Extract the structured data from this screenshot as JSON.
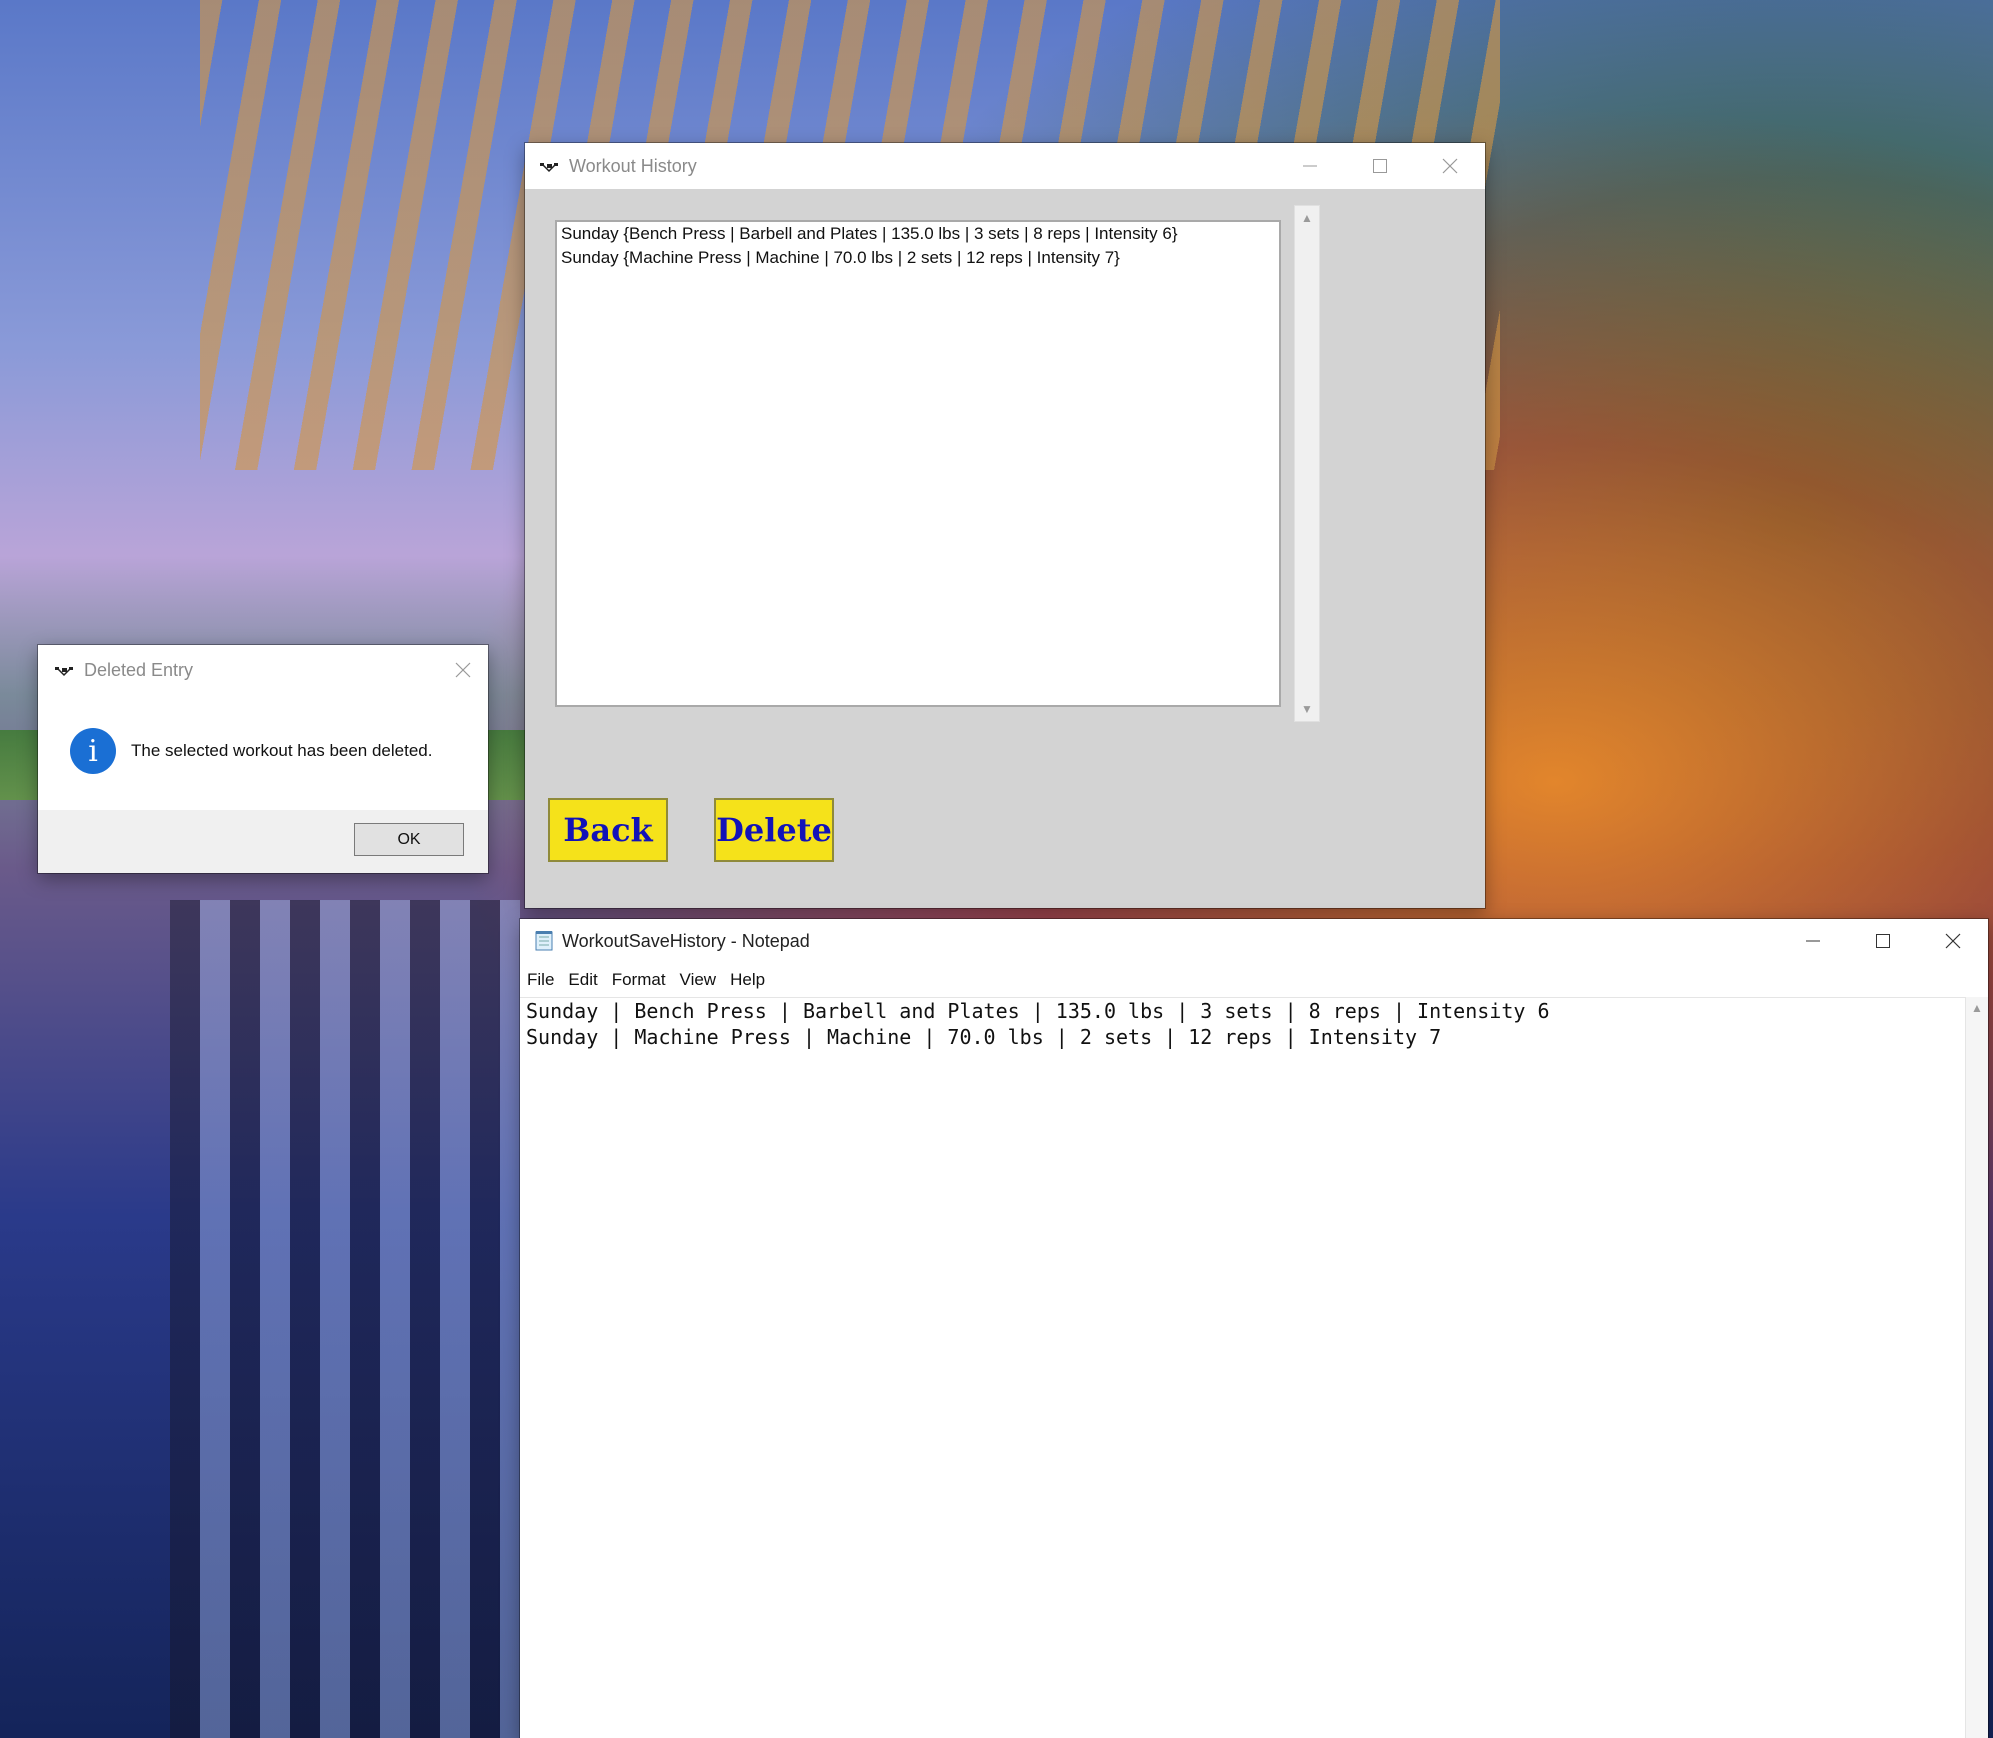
{
  "colors": {
    "button_yellow": "#f5e21a",
    "button_text_blue": "#1212b8",
    "info_blue": "#1a6fd4",
    "window_gray": "#d3d3d3"
  },
  "workout_history": {
    "title": "Workout History",
    "list_items": [
      "Sunday {Bench Press | Barbell and Plates | 135.0 lbs | 3 sets | 8 reps | Intensity 6}",
      "Sunday {Machine Press | Machine | 70.0 lbs | 2 sets | 12 reps | Intensity 7}"
    ],
    "back_label": "Back",
    "delete_label": "Delete"
  },
  "dialog": {
    "title": "Deleted Entry",
    "message": "The selected workout has been deleted.",
    "ok_label": "OK",
    "info_glyph": "i"
  },
  "notepad": {
    "title": "WorkoutSaveHistory - Notepad",
    "menu": [
      "File",
      "Edit",
      "Format",
      "View",
      "Help"
    ],
    "lines": [
      "Sunday | Bench Press | Barbell and Plates | 135.0 lbs | 3 sets | 8 reps | Intensity 6",
      "Sunday | Machine Press | Machine | 70.0 lbs | 2 sets | 12 reps | Intensity 7"
    ]
  },
  "icons": {
    "minimize": "minimize-icon",
    "maximize": "maximize-icon",
    "close": "close-icon",
    "app": "app-icon",
    "info": "info-icon",
    "notepad": "notepad-icon"
  }
}
